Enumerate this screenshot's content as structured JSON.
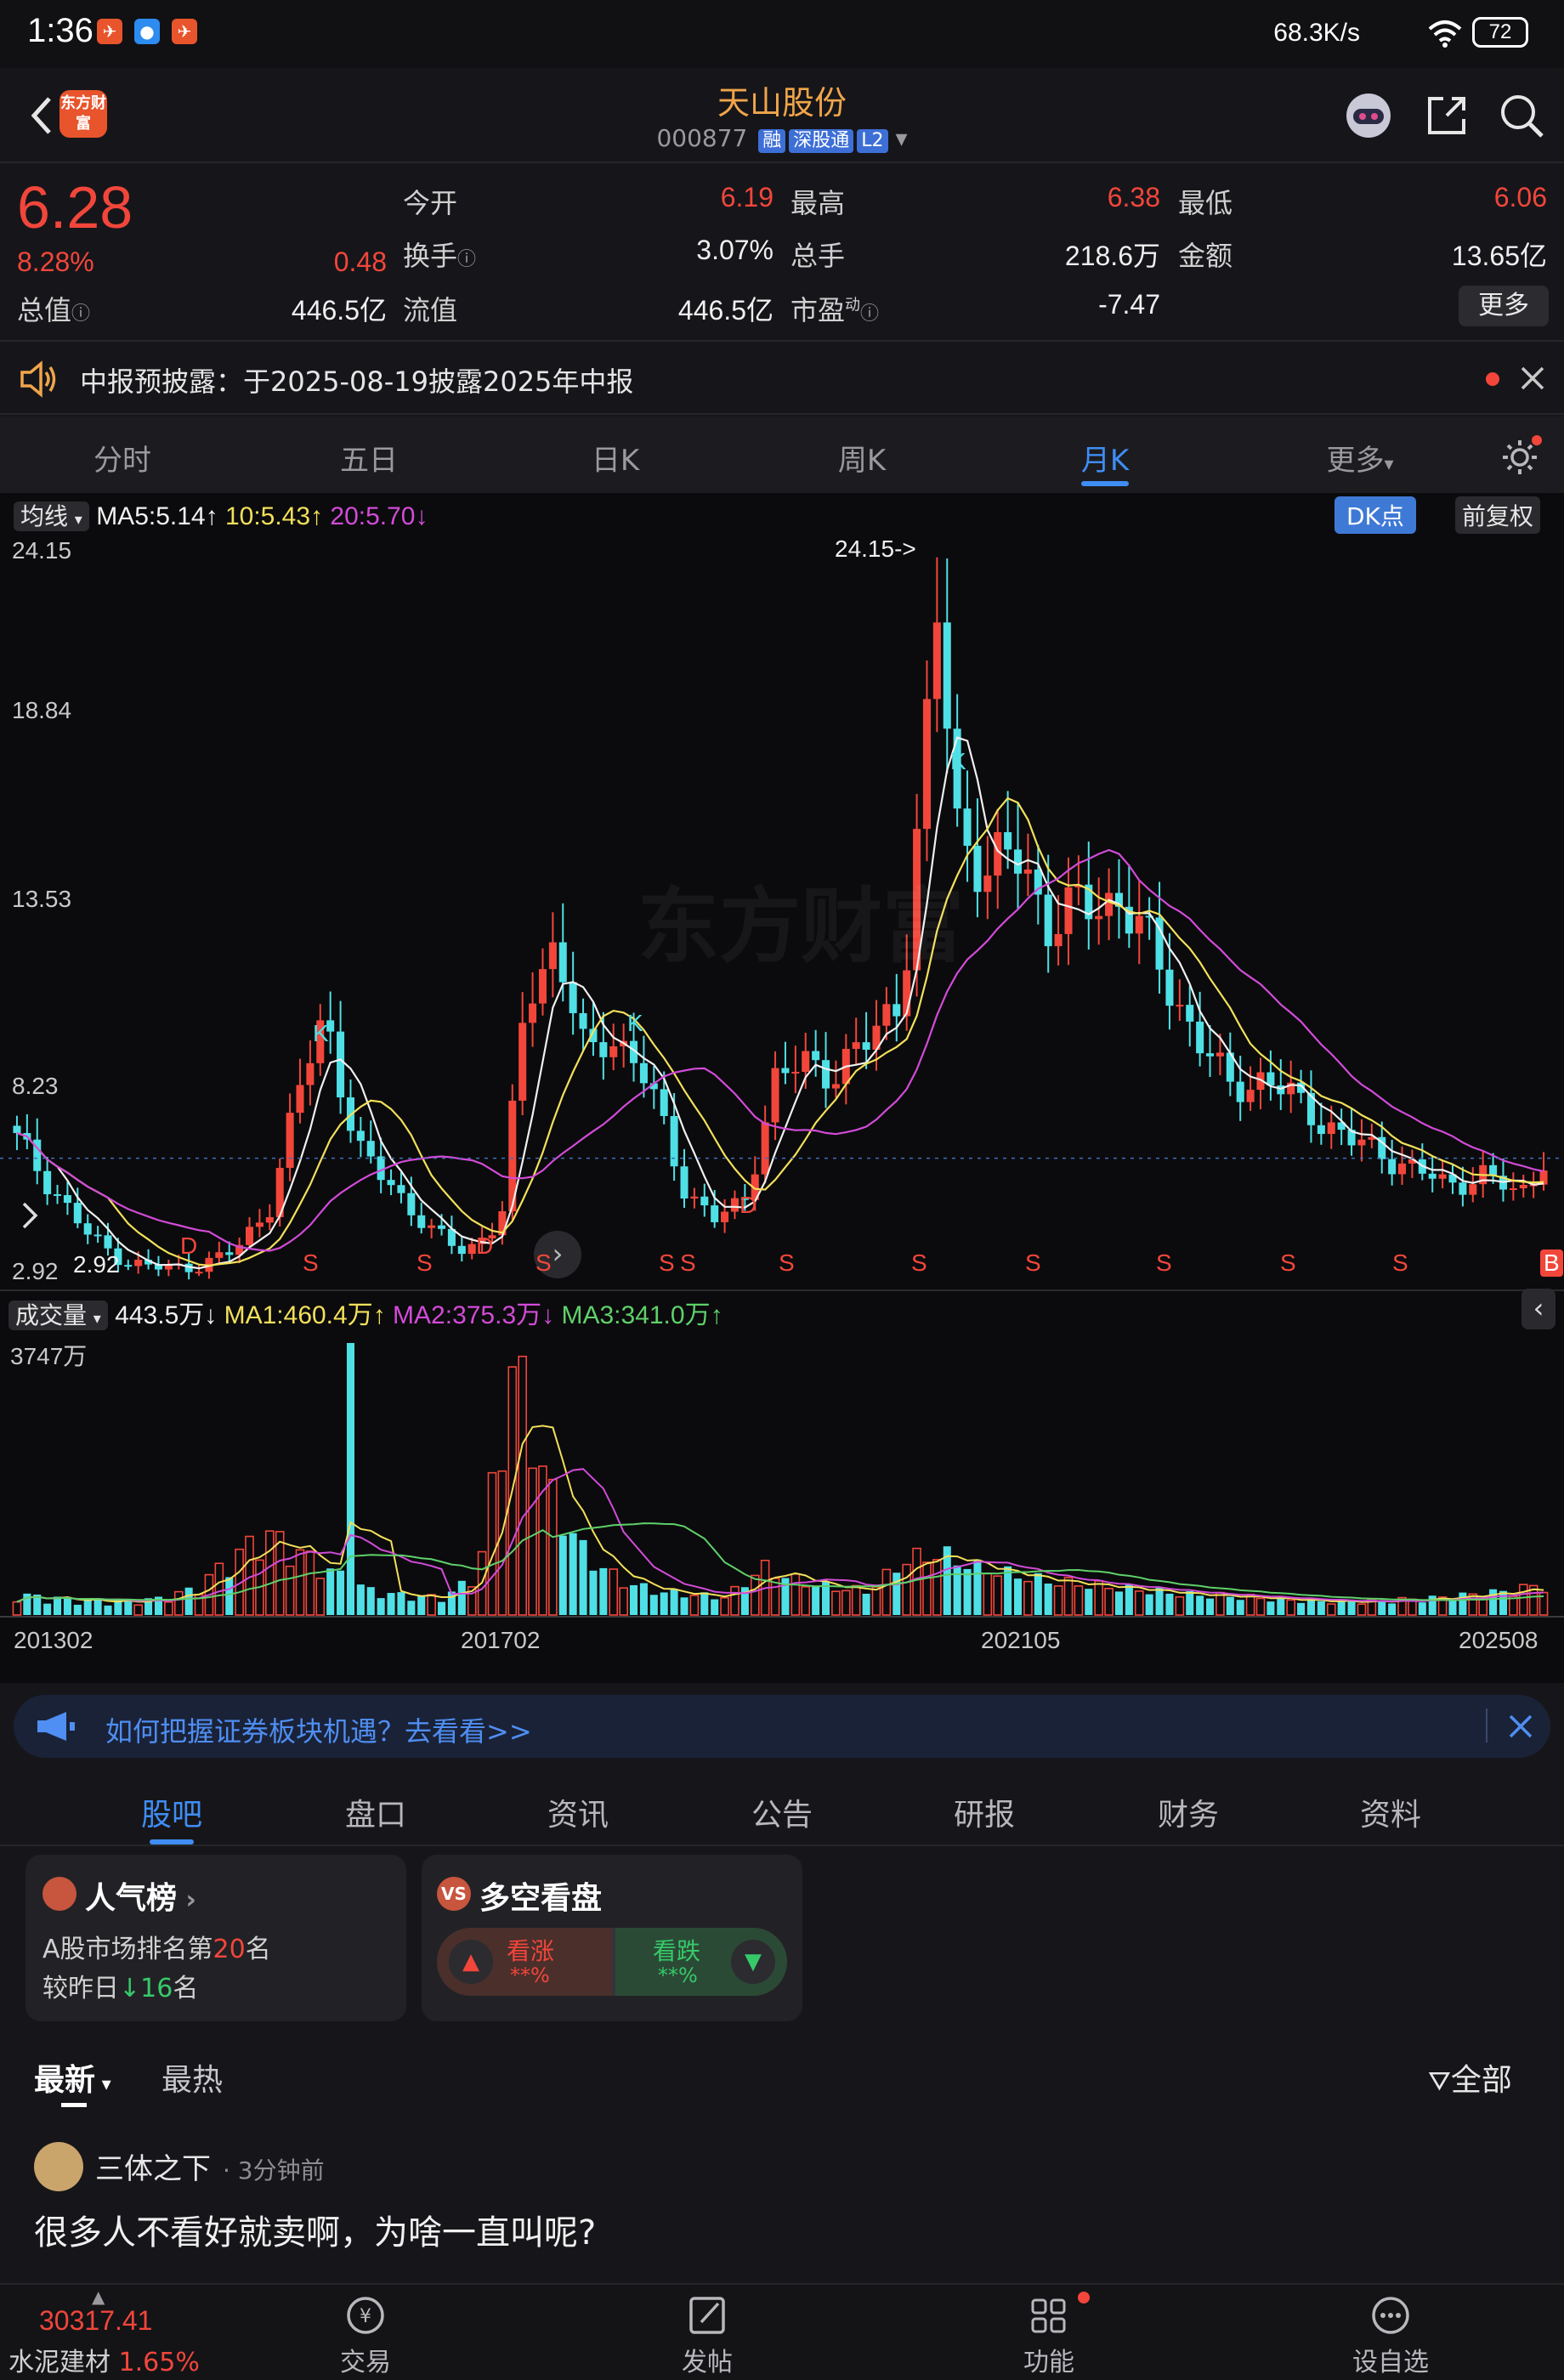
{
  "status_bar": {
    "time": "1:36",
    "speed": "68.3K/s",
    "battery": "72"
  },
  "header": {
    "logo_text": "东方财富",
    "stock_name": "天山股份",
    "stock_code": "000877",
    "tags": [
      "融",
      "深股通",
      "L2"
    ]
  },
  "quote": {
    "price": "6.28",
    "change_pct": "8.28%",
    "change": "0.48",
    "fields": {
      "open_label": "今开",
      "open": "6.19",
      "high_label": "最高",
      "high": "6.38",
      "low_label": "最低",
      "low": "6.06",
      "turnover_label": "换手",
      "turnover": "3.07%",
      "volume_label": "总手",
      "volume": "218.6万",
      "amount_label": "金额",
      "amount": "13.65亿",
      "mcap_label": "总值",
      "mcap": "446.5亿",
      "float_label": "流值",
      "float": "446.5亿",
      "pe_label": "市盈",
      "pe_sup": "动",
      "pe": "-7.47"
    },
    "more_label": "更多"
  },
  "notice": {
    "text": "中报预披露：于2025-08-19披露2025年中报"
  },
  "period_tabs": [
    "分时",
    "五日",
    "日K",
    "周K",
    "月K",
    "更多"
  ],
  "active_period": "月K",
  "chart_overlay": {
    "ma_selector": "均线",
    "ma5": "MA5:5.14↑",
    "ma10": "10:5.43↑",
    "ma20": "20:5.70↓",
    "dk_label": "DK点",
    "adjust_label": "前复权",
    "y_ticks": [
      "24.15",
      "18.84",
      "13.53",
      "8.23",
      "2.92"
    ],
    "max_annotation": "24.15->",
    "min_annotation": "2.92",
    "watermark": "东方财富",
    "signal_letters": [
      "K",
      "K",
      "K",
      "D",
      "D",
      "D",
      "S",
      "S",
      "S",
      "S",
      "S",
      "S",
      "S",
      "S",
      "S",
      "S",
      "S",
      "B"
    ],
    "vol_selector": "成交量",
    "vol_current": "443.5万↓",
    "vol_ma1": "MA1:460.4万↑",
    "vol_ma2": "MA2:375.3万↓",
    "vol_ma3": "MA3:341.0万↑",
    "vol_max": "3747万",
    "x_ticks": [
      "201302",
      "201702",
      "202105",
      "202508"
    ]
  },
  "chart_data": {
    "type": "candlestick",
    "series": [
      {
        "name": "K线",
        "points": [
          [
            2013,
            6.8
          ],
          [
            2013.3,
            5.4
          ],
          [
            2013.6,
            4.0
          ],
          [
            2013.9,
            3.3
          ],
          [
            2014.2,
            3.1
          ],
          [
            2014.5,
            3.2
          ],
          [
            2014.8,
            3.6
          ],
          [
            2015.1,
            5.0
          ],
          [
            2015.35,
            8.5
          ],
          [
            2015.55,
            10.5
          ],
          [
            2015.8,
            6.5
          ],
          [
            2016.1,
            5.5
          ],
          [
            2016.4,
            4.2
          ],
          [
            2016.7,
            3.6
          ],
          [
            2017.0,
            4.5
          ],
          [
            2017.2,
            11.0
          ],
          [
            2017.45,
            12.5
          ],
          [
            2017.7,
            9.0
          ],
          [
            2017.9,
            10.0
          ],
          [
            2018.2,
            8.5
          ],
          [
            2018.5,
            5.5
          ],
          [
            2018.75,
            4.5
          ],
          [
            2019.0,
            5.0
          ],
          [
            2019.25,
            8.5
          ],
          [
            2019.5,
            9.0
          ],
          [
            2019.75,
            8.8
          ],
          [
            2020.0,
            9.5
          ],
          [
            2020.3,
            11.0
          ],
          [
            2020.5,
            18.0
          ],
          [
            2020.6,
            22.0
          ],
          [
            2020.75,
            16.0
          ],
          [
            2021.0,
            14.5
          ],
          [
            2021.3,
            15.0
          ],
          [
            2021.5,
            13.0
          ],
          [
            2021.8,
            13.5
          ],
          [
            2022.1,
            13.8
          ],
          [
            2022.4,
            12.0
          ],
          [
            2022.7,
            10.0
          ],
          [
            2023.0,
            8.3
          ],
          [
            2023.3,
            8.6
          ],
          [
            2023.6,
            7.8
          ],
          [
            2024.0,
            6.8
          ],
          [
            2024.4,
            6.2
          ],
          [
            2024.8,
            5.5
          ],
          [
            2025.1,
            5.8
          ],
          [
            2025.4,
            5.2
          ],
          [
            2025.6,
            6.28
          ]
        ]
      },
      {
        "name": "MA5",
        "color": "#f0f0f0"
      },
      {
        "name": "MA10",
        "color": "#f3e05a"
      },
      {
        "name": "MA20",
        "color": "#d24bd8"
      }
    ],
    "ylim": [
      2.92,
      24.15
    ],
    "volume": [
      3.0,
      2.5,
      2.2,
      2.0,
      2.4,
      3.8,
      8.0,
      12.0,
      9.0,
      6.0,
      3.5,
      2.8,
      2.5,
      6.0,
      37.47,
      18.0,
      9.0,
      5.0,
      3.5,
      3.0,
      2.6,
      7.0,
      5.0,
      4.0,
      3.5,
      8.0,
      9.0,
      7.0,
      6.0,
      5.0,
      4.5,
      4.0,
      3.5,
      3.0,
      2.8,
      2.5,
      2.2,
      2.0,
      2.0,
      2.2,
      2.5,
      3.0,
      3.5,
      4.43
    ]
  },
  "promo": {
    "text": "如何把握证券板块机遇？去看看>>"
  },
  "bottom_tabs": [
    "股吧",
    "盘口",
    "资讯",
    "公告",
    "研报",
    "财务",
    "资料"
  ],
  "active_bottom_tab": "股吧",
  "popularity_card": {
    "title": "人气榜",
    "line1_prefix": "A股市场排名第",
    "rank": "20",
    "line1_suffix": "名",
    "line2_prefix": "较昨日",
    "delta": "16",
    "line2_suffix": "名"
  },
  "sentiment_card": {
    "title": "多空看盘",
    "bull_label": "看涨",
    "bull_value": "**%",
    "bear_label": "看跌",
    "bear_value": "**%"
  },
  "feed_sort": {
    "latest": "最新",
    "hottest": "最热",
    "filter": "全部"
  },
  "post": {
    "author": "三体之下",
    "time": "· 3分钟前",
    "text": "很多人不看好就卖啊，为啥一直叫呢?"
  },
  "bottom_nav": {
    "index_value": "30317.41",
    "index_name": "水泥建材",
    "index_change": "1.65%",
    "items": [
      "交易",
      "发帖",
      "功能",
      "设自选"
    ]
  },
  "colors": {
    "up": "#f2463b",
    "down": "#4fe0e6",
    "accent": "#3f8df5",
    "name": "#f1a54a"
  }
}
